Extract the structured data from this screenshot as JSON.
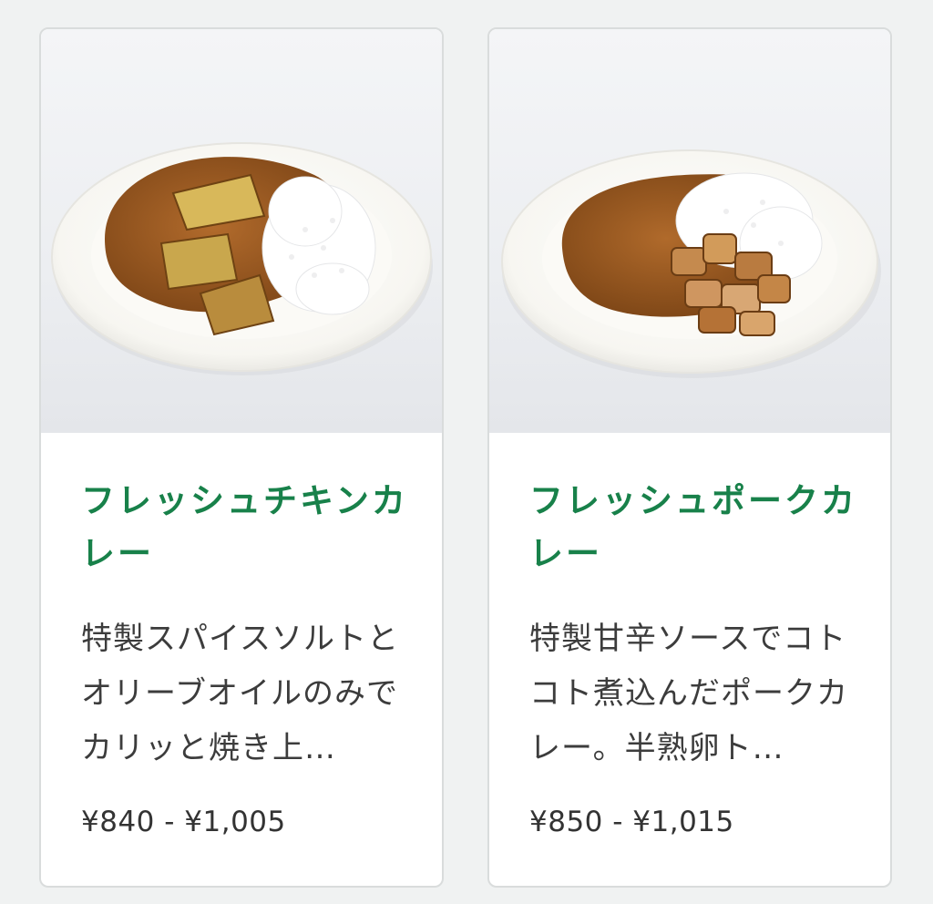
{
  "cards": [
    {
      "image_icon": "chicken-curry-photo",
      "title": "フレッシュチキンカレー",
      "description": "特製スパイスソルトとオリーブオイルのみでカリッと焼き上…",
      "price": "¥840 - ¥1,005"
    },
    {
      "image_icon": "pork-curry-photo",
      "title": "フレッシュポークカレー",
      "description": "特製甘辛ソースでコトコト煮込んだポークカレー。半熟卵ト…",
      "price": "¥850 - ¥1,015"
    }
  ],
  "colors": {
    "title_green": "#18814a",
    "background": "#f0f2f2",
    "card_border": "#d9dcdc",
    "curry": "#9a5a22",
    "rice": "#ffffff"
  }
}
